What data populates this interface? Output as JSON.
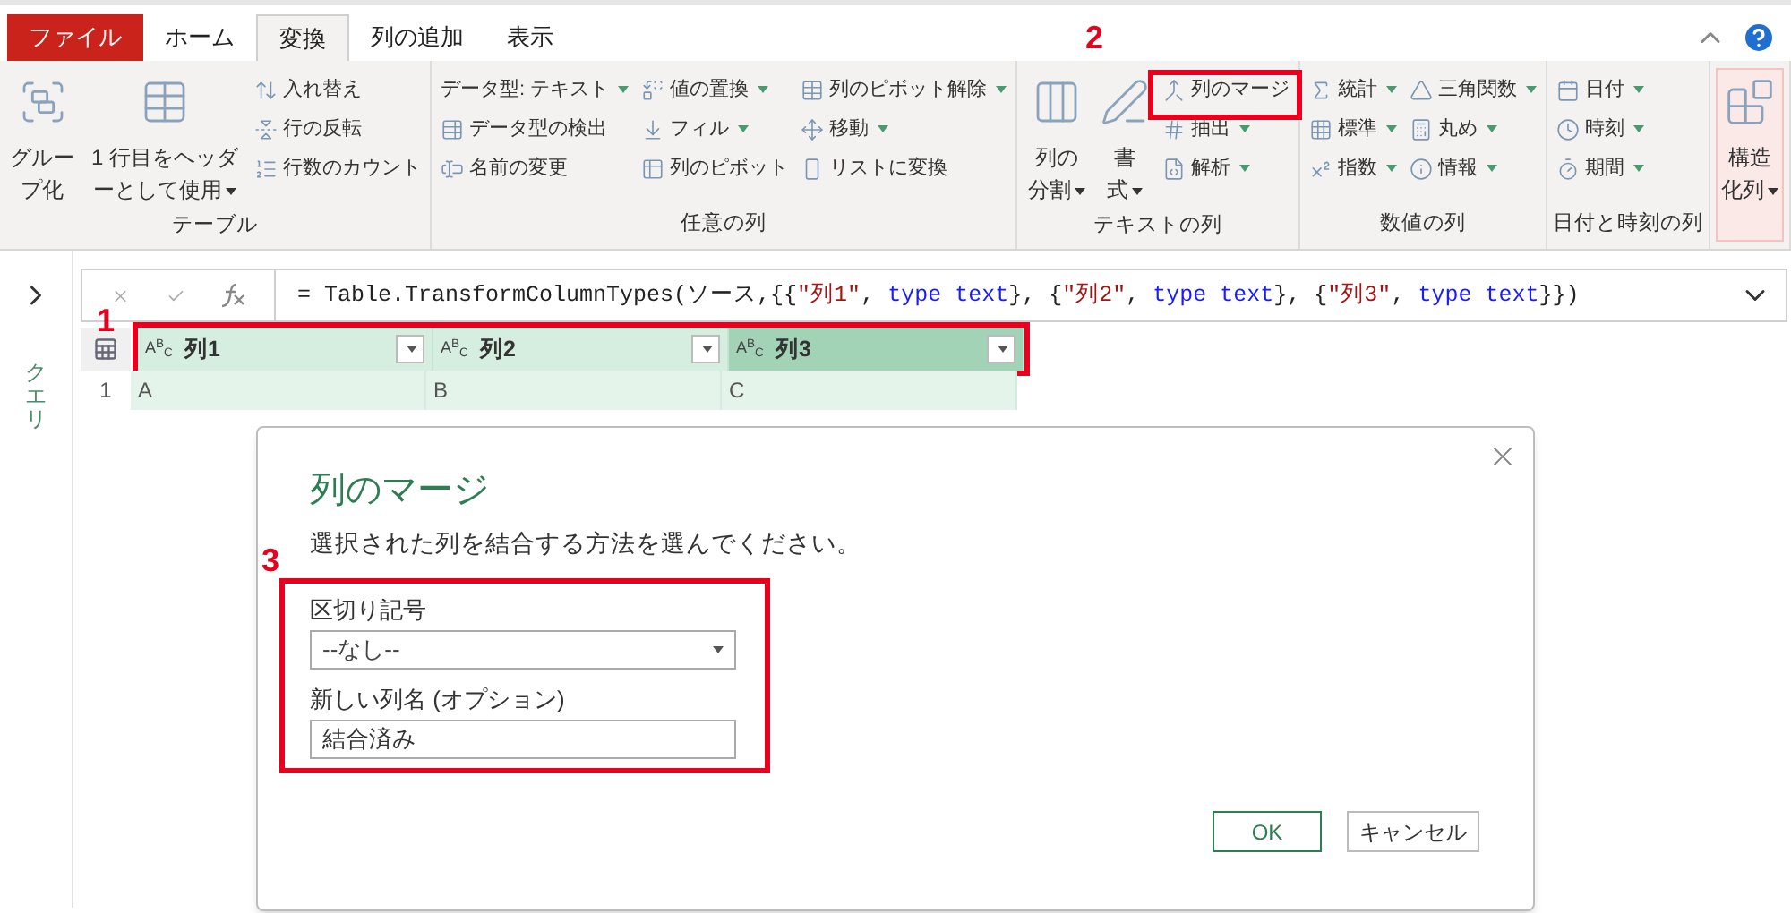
{
  "tabs": [
    {
      "label": "ファイル",
      "kind": "file",
      "selected": false
    },
    {
      "label": "ホーム",
      "kind": "normal",
      "selected": false
    },
    {
      "label": "変換",
      "kind": "normal",
      "selected": true
    },
    {
      "label": "列の追加",
      "kind": "normal",
      "selected": false
    },
    {
      "label": "表示",
      "kind": "normal",
      "selected": false
    }
  ],
  "ribbon": {
    "groups": [
      {
        "label": "テーブル",
        "highlighted": false,
        "items": [
          {
            "kind": "large",
            "label": "グループ化",
            "dropdown": false
          },
          {
            "kind": "large",
            "label": "1 行目をヘッダーとして使用",
            "dropdown": true
          },
          {
            "kind": "small",
            "label": "入れ替え",
            "dropdown": false
          },
          {
            "kind": "small",
            "label": "行の反転",
            "dropdown": false
          },
          {
            "kind": "small",
            "label": "行数のカウント",
            "dropdown": false
          }
        ]
      },
      {
        "label": "任意の列",
        "highlighted": false,
        "items": [
          {
            "kind": "small",
            "label": "データ型: テキスト",
            "dropdown": true
          },
          {
            "kind": "small",
            "label": "データ型の検出",
            "dropdown": false
          },
          {
            "kind": "small",
            "label": "名前の変更",
            "dropdown": false
          },
          {
            "kind": "small",
            "label": "値の置換",
            "dropdown": true
          },
          {
            "kind": "small",
            "label": "フィル",
            "dropdown": true
          },
          {
            "kind": "small",
            "label": "列のピボット",
            "dropdown": false
          },
          {
            "kind": "small",
            "label": "列のピボット解除",
            "dropdown": true
          },
          {
            "kind": "small",
            "label": "移動",
            "dropdown": true
          },
          {
            "kind": "small",
            "label": "リストに変換",
            "dropdown": false
          }
        ]
      },
      {
        "label": "テキストの列",
        "highlighted": false,
        "items": [
          {
            "kind": "large",
            "label": "列の分割",
            "dropdown": true
          },
          {
            "kind": "large",
            "label": "書式",
            "dropdown": true
          },
          {
            "kind": "small",
            "label": "列のマージ",
            "dropdown": false
          },
          {
            "kind": "small",
            "label": "抽出",
            "dropdown": true
          },
          {
            "kind": "small",
            "label": "解析",
            "dropdown": true
          }
        ]
      },
      {
        "label": "数値の列",
        "highlighted": false,
        "items": [
          {
            "kind": "small",
            "label": "統計",
            "dropdown": true
          },
          {
            "kind": "small",
            "label": "標準",
            "dropdown": true
          },
          {
            "kind": "small",
            "label": "指数",
            "dropdown": true
          },
          {
            "kind": "small",
            "label": "三角関数",
            "dropdown": true
          },
          {
            "kind": "small",
            "label": "丸め",
            "dropdown": true
          },
          {
            "kind": "small",
            "label": "情報",
            "dropdown": true
          }
        ]
      },
      {
        "label": "日付と時刻の列",
        "highlighted": false,
        "items": [
          {
            "kind": "small",
            "label": "日付",
            "dropdown": true
          },
          {
            "kind": "small",
            "label": "時刻",
            "dropdown": true
          },
          {
            "kind": "small",
            "label": "期間",
            "dropdown": true
          }
        ]
      },
      {
        "highlighted": true,
        "items": [
          {
            "kind": "large",
            "label": "構造化列",
            "dropdown": true
          }
        ]
      }
    ]
  },
  "queries_pane": {
    "label": "クエリ"
  },
  "formula": [
    {
      "kind": "plain",
      "text": "= Table.TransformColumnTypes(ソース,{{"
    },
    {
      "kind": "string",
      "text": "\"列1\""
    },
    {
      "kind": "plain",
      "text": ", "
    },
    {
      "kind": "keyword",
      "text": "type text"
    },
    {
      "kind": "plain",
      "text": "}, {"
    },
    {
      "kind": "string",
      "text": "\"列2\""
    },
    {
      "kind": "plain",
      "text": ", "
    },
    {
      "kind": "keyword",
      "text": "type text"
    },
    {
      "kind": "plain",
      "text": "}, {"
    },
    {
      "kind": "string",
      "text": "\"列3\""
    },
    {
      "kind": "plain",
      "text": ", "
    },
    {
      "kind": "keyword",
      "text": "type text"
    },
    {
      "kind": "plain",
      "text": "}})"
    }
  ],
  "table": {
    "columns": [
      {
        "type": "A$^{B}$$_{C}$",
        "name": "列1",
        "selected": false
      },
      {
        "type": "A$^{B}$$_{C}$",
        "name": "列2",
        "selected": false
      },
      {
        "type": "A$^{B}$$_{C}$",
        "name": "列3",
        "selected": true
      }
    ],
    "rows": [
      {
        "number": "1",
        "cells": [
          "A",
          "B",
          "C"
        ]
      }
    ]
  },
  "dialog": {
    "title": "列のマージ",
    "description": "選択された列を結合する方法を選んでください。",
    "separator_label": "区切り記号",
    "separator_value": "--なし--",
    "name_label": "新しい列名 (オプション)",
    "name_value": "結合済み",
    "buttons": [
      {
        "label": "OK",
        "kind": "primary"
      },
      {
        "label": "キャンセル",
        "kind": "secondary"
      }
    ]
  },
  "annotations": [
    {
      "label": "1"
    },
    {
      "label": "2"
    },
    {
      "label": "3"
    }
  ]
}
